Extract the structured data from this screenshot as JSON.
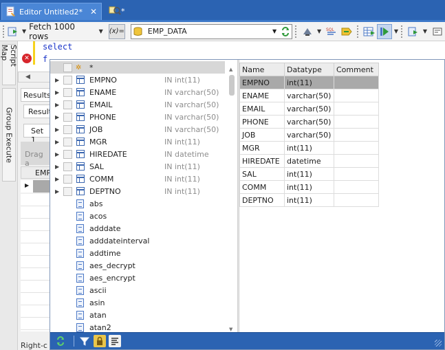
{
  "tabs": [
    {
      "label": "Editor Untitled2*",
      "close": "✕"
    },
    {
      "label": "*"
    }
  ],
  "toolbar": {
    "fetch_label": "Fetch 1000 rows",
    "expr_label": "(x)=",
    "table_combo_value": "EMP_DATA"
  },
  "side_tabs": [
    "Script Map",
    "Group Execute"
  ],
  "editor": {
    "line1": "select",
    "line2": "f"
  },
  "results": {
    "tab_label": "Results",
    "sub_tab_label": "Result",
    "set_tab_label": "Set 1",
    "drag_hint": "Drag a",
    "column_header": "EMP",
    "status_text": "Right-c"
  },
  "autocomplete": {
    "star_label": "*",
    "columns": [
      {
        "name": "EMPNO",
        "type": "IN int(11)"
      },
      {
        "name": "ENAME",
        "type": "IN varchar(50)"
      },
      {
        "name": "EMAIL",
        "type": "IN varchar(50)"
      },
      {
        "name": "PHONE",
        "type": "IN varchar(50)"
      },
      {
        "name": "JOB",
        "type": "IN varchar(50)"
      },
      {
        "name": "MGR",
        "type": "IN int(11)"
      },
      {
        "name": "HIREDATE",
        "type": "IN datetime"
      },
      {
        "name": "SAL",
        "type": "IN int(11)"
      },
      {
        "name": "COMM",
        "type": "IN int(11)"
      },
      {
        "name": "DEPTNO",
        "type": "IN int(11)"
      }
    ],
    "functions": [
      "abs",
      "acos",
      "adddate",
      "adddateinterval",
      "addtime",
      "aes_decrypt",
      "aes_encrypt",
      "ascii",
      "asin",
      "atan",
      "atan2"
    ]
  },
  "column_table": {
    "headers": [
      "Name",
      "Datatype",
      "Comment"
    ],
    "rows": [
      [
        "EMPNO",
        "int(11)",
        ""
      ],
      [
        "ENAME",
        "varchar(50)",
        ""
      ],
      [
        "EMAIL",
        "varchar(50)",
        ""
      ],
      [
        "PHONE",
        "varchar(50)",
        ""
      ],
      [
        "JOB",
        "varchar(50)",
        ""
      ],
      [
        "MGR",
        "int(11)",
        ""
      ],
      [
        "HIREDATE",
        "datetime",
        ""
      ],
      [
        "SAL",
        "int(11)",
        ""
      ],
      [
        "COMM",
        "int(11)",
        ""
      ],
      [
        "DEPTNO",
        "int(11)",
        ""
      ]
    ],
    "selected_row": 0
  },
  "colors": {
    "tabbar_blue": "#2b63b2",
    "keyword_blue": "#1a34c8",
    "selection_gray": "#a9a9a9",
    "error_red": "#d7262c"
  }
}
